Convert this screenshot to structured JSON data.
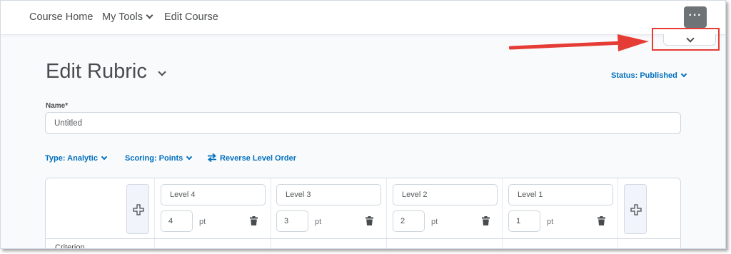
{
  "nav": {
    "links": [
      {
        "label": "Course Home"
      },
      {
        "label": "My Tools"
      },
      {
        "label": "Edit Course"
      }
    ],
    "more_label": "···"
  },
  "page": {
    "title": "Edit Rubric",
    "status": "Status: Published"
  },
  "form": {
    "name_label": "Name*",
    "name_value": "Untitled"
  },
  "options": {
    "type": "Type: Analytic",
    "scoring": "Scoring: Points",
    "reverse": "Reverse Level Order"
  },
  "rubric": {
    "levels": [
      {
        "name": "Level 4",
        "points": "4"
      },
      {
        "name": "Level 3",
        "points": "3"
      },
      {
        "name": "Level 2",
        "points": "2"
      },
      {
        "name": "Level 1",
        "points": "1"
      }
    ],
    "points_unit": "pt",
    "criteria_header": "Criterion"
  },
  "colors": {
    "accent": "#006fbf",
    "callout": "#e53d35",
    "text": "#494c4e"
  },
  "icons": [
    "chevron-down-icon",
    "more-icon",
    "swap-icon",
    "plus-icon",
    "trash-icon"
  ]
}
